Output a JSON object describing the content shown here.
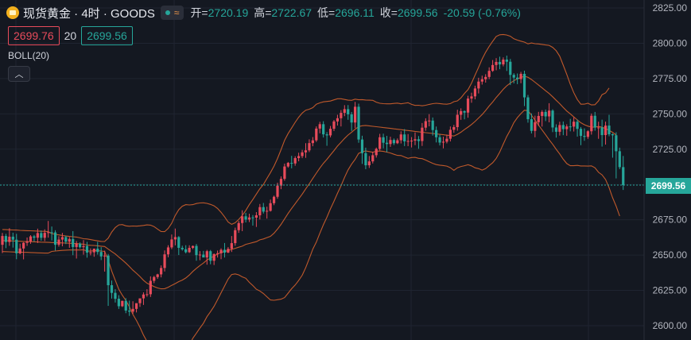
{
  "header": {
    "symbol_title": "现货黄金 · 4时 · GOODS",
    "open_label": "开=",
    "open_value": "2720.19",
    "high_label": "高=",
    "high_value": "2722.67",
    "low_label": "低=",
    "low_value": "2696.11",
    "close_label": "收=",
    "close_value": "2699.56",
    "change": "-20.59 (-0.76%)"
  },
  "bid_ask": {
    "sell": "2699.76",
    "spread": "20",
    "buy": "2699.56"
  },
  "indicator": {
    "label": "BOLL(20)",
    "collapse_icon": "chevron-up-icon"
  },
  "last_price_label": "2699.56",
  "colors": {
    "up": "#e84b5b",
    "down": "#26a69a",
    "band": "#c0592b",
    "background": "#141821",
    "grid": "#1f2431"
  },
  "chart_data": {
    "type": "candlestick",
    "ylim": [
      2593,
      2828
    ],
    "yticks": [
      "2825.00",
      "2800.00",
      "2775.00",
      "2750.00",
      "2725.00",
      "2700.00",
      "2675.00",
      "2650.00",
      "2625.00",
      "2600.00"
    ],
    "grid": true,
    "last_price": 2699.56,
    "open": [
      2657.29,
      2663.51,
      2659.29,
      2663.03,
      2660.92,
      2651.26,
      2654.67,
      2658.71,
      2659.69,
      2663.22,
      2662.29,
      2665.6,
      2662.25,
      2665.76,
      2666.2,
      2666.05,
      2657.3,
      2660.98,
      2662.76,
      2659.51,
      2661.38,
      2655.73,
      2658.08,
      2655.61,
      2656.4,
      2651.76,
      2651.98,
      2654.55,
      2652.2,
      2649.06,
      2649.65,
      2628.67,
      2623.24,
      2619.05,
      2613.79,
      2617.58,
      2610.72,
      2609.97,
      2611.9,
      2615.95,
      2619.36,
      2622.12,
      2622.28,
      2631.78,
      2634.44,
      2636.34,
      2640.86,
      2650.52,
      2655.43,
      2661.09,
      2662.75,
      2655.14,
      2654.11,
      2652.04,
      2655.14,
      2656.47,
      2649.96,
      2650.35,
      2648.32,
      2652.75,
      2645.98,
      2650.72,
      2651.29,
      2653.76,
      2651.78,
      2654.44,
      2658.46,
      2667.64,
      2672.69,
      2677.47,
      2675.17,
      2676.66,
      2676.5,
      2678.17,
      2683.97,
      2680.77,
      2681.34,
      2686.74,
      2691.28,
      2699.17,
      2703.97,
      2712.73,
      2715.29,
      2714.89,
      2718.67,
      2720.1,
      2722.74,
      2724.18,
      2729.3,
      2731.25,
      2739.58,
      2742.69,
      2735.5,
      2734.76,
      2739.44,
      2744.63,
      2746.91,
      2750.72,
      2753.33,
      2749.65,
      2743.87,
      2755.04,
      2731.84,
      2722.19,
      2713.59,
      2716.35,
      2720.71,
      2725.2,
      2733.43,
      2729.54,
      2728.63,
      2731.52,
      2729.22,
      2731.31,
      2735.43,
      2730.52,
      2730.81,
      2731.08,
      2732.02,
      2730.76,
      2740.23,
      2744.84,
      2745.25,
      2738.54,
      2733.43,
      2729.67,
      2730.3,
      2732.4,
      2738.73,
      2740.62,
      2749.35,
      2751.93,
      2750.9,
      2760.83,
      2762.39,
      2767.98,
      2772.85,
      2774.52,
      2776.15,
      2780.45,
      2784.59,
      2786.78,
      2785.02,
      2788.43,
      2786.9,
      2777.61,
      2775.68,
      2774.62,
      2778.34,
      2761.67,
      2746.22,
      2737.95,
      2744.07,
      2748.54,
      2751.38,
      2748.21,
      2752.31,
      2740.36,
      2737.31,
      2742.08,
      2739.17,
      2741.1,
      2740.96,
      2744.44,
      2739.39,
      2734.41,
      2733.72,
      2737.67,
      2748.66,
      2740.28,
      2740.38,
      2734.98,
      2741.7,
      2735.54,
      2734.83,
      2723.54,
      2712.29
    ],
    "high": [
      2665.69,
      2665.06,
      2669.06,
      2665.86,
      2665.06,
      2658.1,
      2659.12,
      2662.45,
      2664.1,
      2664.27,
      2668.71,
      2667.43,
      2668.22,
      2674.14,
      2670.23,
      2667.61,
      2663.33,
      2665.71,
      2663.8,
      2662.77,
      2666.98,
      2659.99,
      2659.01,
      2660.61,
      2659.37,
      2654.74,
      2654.63,
      2659.38,
      2655.62,
      2653.15,
      2650.81,
      2631.97,
      2625.87,
      2621.6,
      2617.74,
      2619.48,
      2617.76,
      2617.32,
      2615.93,
      2618.12,
      2623.61,
      2625.86,
      2634.92,
      2635.32,
      2636.76,
      2642.69,
      2653.3,
      2656.99,
      2664.59,
      2668.79,
      2663.41,
      2656.66,
      2656.99,
      2656.95,
      2656.75,
      2657.81,
      2652.8,
      2652.96,
      2653.68,
      2653.61,
      2651.15,
      2653.2,
      2654.79,
      2658.55,
      2655.71,
      2663.49,
      2669.44,
      2674.2,
      2681.74,
      2679.95,
      2679.29,
      2678.34,
      2680.42,
      2686.18,
      2686.91,
      2684.27,
      2689.3,
      2692.08,
      2701.25,
      2705.71,
      2714.77,
      2715.93,
      2720.27,
      2719.98,
      2722.48,
      2724.5,
      2729.25,
      2731.97,
      2733.56,
      2741.12,
      2744.36,
      2744.79,
      2737.12,
      2741.42,
      2745.67,
      2749.36,
      2752.67,
      2756.15,
      2756.23,
      2751.33,
      2758.47,
      2757.23,
      2734.52,
      2726.08,
      2720.15,
      2723.22,
      2726.12,
      2735.84,
      2735.97,
      2734.43,
      2733.82,
      2732.59,
      2732.59,
      2737.67,
      2739.21,
      2735.7,
      2733.54,
      2736.88,
      2734.3,
      2743.51,
      2746.86,
      2749.79,
      2747.43,
      2741.03,
      2735.27,
      2733.8,
      2735.33,
      2741.07,
      2742.19,
      2752.92,
      2753.92,
      2752.45,
      2762.8,
      2764.99,
      2769.95,
      2775.56,
      2777.05,
      2778.09,
      2782.94,
      2788.11,
      2789.46,
      2790.49,
      2789.99,
      2791.25,
      2788.89,
      2778.8,
      2778.58,
      2779.73,
      2780.58,
      2763.39,
      2750.34,
      2748.74,
      2751.42,
      2752.61,
      2753.07,
      2757.54,
      2753.21,
      2742.62,
      2744.43,
      2744.59,
      2742.62,
      2746.46,
      2747.53,
      2745.99,
      2740.68,
      2739.71,
      2738.35,
      2750.24,
      2751.37,
      2744.46,
      2745.89,
      2744.49,
      2749.35,
      2736.18,
      2736.97,
      2726.07,
      2720.19
    ],
    "low": [
      2651.43,
      2654.92,
      2656.58,
      2655.31,
      2647.07,
      2650.56,
      2646.97,
      2656.52,
      2658.0,
      2659.64,
      2658.52,
      2660.2,
      2659.87,
      2662.35,
      2660.37,
      2653.19,
      2655.97,
      2656.22,
      2657.8,
      2655.18,
      2649.95,
      2647.55,
      2654.63,
      2650.32,
      2648.16,
      2649.82,
      2648.82,
      2650.37,
      2646.46,
      2638.32,
      2614.03,
      2619.2,
      2616.41,
      2611.88,
      2613.25,
      2608.85,
      2606.93,
      2608.38,
      2609.41,
      2613.33,
      2614.7,
      2620.52,
      2620.34,
      2630.11,
      2633.14,
      2634.22,
      2638.4,
      2648.44,
      2654.19,
      2656.9,
      2650.06,
      2653.16,
      2651.19,
      2651.51,
      2654.21,
      2646.01,
      2646.38,
      2648.59,
      2643.2,
      2643.49,
      2642.96,
      2648.28,
      2647.09,
      2648.28,
      2651.4,
      2652.2,
      2656.62,
      2665.74,
      2666.95,
      2673.13,
      2673.39,
      2670.88,
      2669.93,
      2675.21,
      2679.45,
      2675.82,
      2680.81,
      2685.35,
      2689.91,
      2696.67,
      2702.68,
      2711.86,
      2711.43,
      2713.27,
      2716.41,
      2718.63,
      2718.85,
      2722.94,
      2727.07,
      2730.12,
      2736.23,
      2733.26,
      2727.38,
      2733.37,
      2737.85,
      2741.72,
      2741.09,
      2748.36,
      2745.81,
      2737.94,
      2739.89,
      2729.53,
      2714.56,
      2710.82,
      2711.72,
      2714.88,
      2719.04,
      2724.12,
      2725.56,
      2722.88,
      2726.61,
      2727.9,
      2728.61,
      2729.04,
      2727.19,
      2727.14,
      2726.2,
      2727.86,
      2725.29,
      2727.29,
      2738.04,
      2741.19,
      2734.61,
      2729.77,
      2727.62,
      2725.57,
      2729.09,
      2730.47,
      2736.65,
      2738.09,
      2745.78,
      2746.14,
      2747.27,
      2757.86,
      2760.29,
      2764.46,
      2770.73,
      2772.14,
      2774.59,
      2779.76,
      2780.87,
      2781.61,
      2783.64,
      2780.38,
      2770.39,
      2771.55,
      2771.04,
      2771.71,
      2755.51,
      2743.77,
      2736.12,
      2733.44,
      2741.41,
      2740.99,
      2744.89,
      2744.01,
      2737.07,
      2733.17,
      2734.64,
      2734.9,
      2734.5,
      2737.64,
      2737.49,
      2733.9,
      2727.83,
      2730.93,
      2732.29,
      2735.31,
      2738.06,
      2732.34,
      2726.83,
      2728.24,
      2734.12,
      2718.96,
      2704.29,
      2710.85,
      2696.11
    ],
    "close": [
      2663.51,
      2659.29,
      2663.03,
      2660.92,
      2651.26,
      2654.67,
      2658.71,
      2659.69,
      2663.22,
      2662.29,
      2665.6,
      2662.25,
      2665.76,
      2666.2,
      2666.05,
      2657.3,
      2660.98,
      2662.76,
      2659.51,
      2661.38,
      2655.73,
      2658.08,
      2655.61,
      2656.4,
      2651.76,
      2651.98,
      2654.55,
      2652.2,
      2649.06,
      2649.65,
      2628.67,
      2623.24,
      2619.05,
      2613.79,
      2617.58,
      2610.72,
      2609.97,
      2611.9,
      2615.95,
      2619.36,
      2622.12,
      2622.28,
      2631.78,
      2634.44,
      2636.34,
      2640.86,
      2650.52,
      2655.43,
      2661.09,
      2662.75,
      2655.14,
      2654.11,
      2652.04,
      2655.14,
      2656.47,
      2649.96,
      2650.35,
      2648.32,
      2652.75,
      2645.98,
      2650.72,
      2651.29,
      2653.76,
      2651.78,
      2654.44,
      2658.46,
      2667.64,
      2672.69,
      2677.47,
      2675.17,
      2676.66,
      2676.5,
      2678.17,
      2683.97,
      2680.77,
      2681.34,
      2686.74,
      2691.28,
      2699.17,
      2703.97,
      2712.73,
      2715.29,
      2714.89,
      2718.67,
      2720.1,
      2722.74,
      2724.18,
      2729.3,
      2731.25,
      2739.58,
      2742.69,
      2735.5,
      2734.76,
      2739.44,
      2744.63,
      2746.91,
      2750.72,
      2753.33,
      2749.65,
      2743.87,
      2755.04,
      2731.84,
      2722.19,
      2713.59,
      2716.35,
      2720.71,
      2725.2,
      2733.43,
      2729.54,
      2728.63,
      2731.52,
      2729.22,
      2731.31,
      2735.43,
      2730.52,
      2730.81,
      2731.08,
      2732.02,
      2730.76,
      2740.23,
      2744.84,
      2745.25,
      2738.54,
      2733.43,
      2729.67,
      2730.3,
      2732.4,
      2738.73,
      2740.62,
      2749.35,
      2751.93,
      2750.9,
      2760.83,
      2762.39,
      2767.98,
      2772.85,
      2774.52,
      2776.15,
      2780.45,
      2784.59,
      2786.78,
      2785.02,
      2788.43,
      2786.9,
      2777.61,
      2775.68,
      2774.62,
      2778.34,
      2761.67,
      2746.22,
      2737.95,
      2744.07,
      2748.54,
      2751.38,
      2748.21,
      2752.31,
      2740.36,
      2737.31,
      2742.08,
      2739.17,
      2741.1,
      2740.96,
      2744.44,
      2739.39,
      2734.41,
      2733.72,
      2737.67,
      2748.66,
      2740.28,
      2740.38,
      2734.98,
      2741.7,
      2735.54,
      2734.83,
      2723.54,
      2712.29,
      2699.56
    ],
    "boll_upper": [
      2668.1,
      2668.0,
      2667.9,
      2667.8,
      2667.7,
      2667.5,
      2667.4,
      2667.3,
      2667.2,
      2667.1,
      2667.0,
      2666.9,
      2666.8,
      2666.6,
      2665.2,
      2664.7,
      2664.3,
      2663.9,
      2663.5,
      2663.2,
      2663.0,
      2662.8,
      2662.2,
      2661.6,
      2661.4,
      2661.0,
      2660.5,
      2660.1,
      2659.7,
      2659.6,
      2662.0,
      2666.3,
      2669.5,
      2671.4,
      2671.6,
      2670.7,
      2670.4,
      2670.6,
      2670.5,
      2670.7,
      2671.0,
      2671.4,
      2671.2,
      2670.2,
      2668.4,
      2666.7,
      2666.6,
      2668.9,
      2672.5,
      2678.1,
      2682.1,
      2684.6,
      2685.7,
      2685.5,
      2685.7,
      2686.5,
      2686.9,
      2687.0,
      2686.6,
      2685.9,
      2684.9,
      2683.0,
      2680.3,
      2677.0,
      2673.4,
      2671.8,
      2672.9,
      2675.2,
      2678.0,
      2681.6,
      2685.7,
      2689.4,
      2693.2,
      2697.0,
      2700.0,
      2704.3,
      2708.4,
      2713.0,
      2718.4,
      2724.6,
      2731.3,
      2736.0,
      2740.0,
      2744.0,
      2747.6,
      2750.6,
      2752.6,
      2753.3,
      2754.4,
      2756.8,
      2757.8,
      2758.5,
      2758.8,
      2759.1,
      2759.9,
      2760.7,
      2760.7,
      2760.2,
      2759.7,
      2759.6,
      2760.4,
      2760.0,
      2760.1,
      2759.8,
      2759.7,
      2759.6,
      2758.3,
      2757.5,
      2757.2,
      2757.1,
      2757.1,
      2757.4,
      2757.6,
      2757.1,
      2757.5,
      2757.9,
      2756.7,
      2756.0,
      2756.1,
      2755.7,
      2756.1,
      2756.7,
      2757.2,
      2757.5,
      2757.3,
      2757.0,
      2756.8,
      2757.3,
      2758.6,
      2759.2,
      2761.3,
      2764.5,
      2767.2,
      2771.8,
      2777.4,
      2783.0,
      2788.8,
      2793.6,
      2797.8,
      2801.4,
      2804.8,
      2806.0,
      2806.2,
      2805.8,
      2805.0,
      2803.2,
      2802.2,
      2801.5,
      2800.8,
      2799.6,
      2800.2,
      2799.7,
      2799.5,
      2799.2,
      2798.8,
      2798.5,
      2797.1,
      2794.7,
      2790.8,
      2784.5,
      2777.9,
      2771.0,
      2765.0,
      2760.1,
      2756.8,
      2756.9,
      2757.5,
      2756.3,
      2756.5,
      2759.2,
      2763.6,
      2764.8,
      2768.3
    ],
    "boll_mid": [
      2660.3,
      2660.2,
      2660.1,
      2660.0,
      2659.9,
      2659.8,
      2659.7,
      2659.6,
      2659.5,
      2659.4,
      2659.3,
      2659.2,
      2659.1,
      2659.0,
      2658.9,
      2658.8,
      2658.7,
      2658.6,
      2658.5,
      2658.4,
      2658.3,
      2658.2,
      2657.9,
      2657.7,
      2657.1,
      2656.9,
      2656.8,
      2656.6,
      2656.3,
      2656.1,
      2654.2,
      2652.5,
      2650.8,
      2648.6,
      2646.6,
      2644.3,
      2641.9,
      2639.3,
      2637.1,
      2634.8,
      2632.2,
      2630.1,
      2628.9,
      2627.7,
      2626.7,
      2626.1,
      2626.2,
      2627.2,
      2628.6,
      2629.8,
      2631.2,
      2632.3,
      2633.8,
      2635.9,
      2638.4,
      2640.6,
      2642.6,
      2644.4,
      2646.5,
      2647.9,
      2649.3,
      2650.7,
      2651.8,
      2652.6,
      2653.2,
      2654.0,
      2654.8,
      2655.6,
      2656.3,
      2657.6,
      2658.2,
      2658.9,
      2659.5,
      2660.8,
      2661.4,
      2662.4,
      2663.3,
      2665.5,
      2668.4,
      2671.7,
      2675.6,
      2679.5,
      2683.1,
      2686.4,
      2689.8,
      2693.2,
      2696.9,
      2700.4,
      2704.3,
      2708.0,
      2711.6,
      2715.0,
      2717.8,
      2720.9,
      2724.0,
      2727.2,
      2729.9,
      2732.6,
      2735.0,
      2737.0,
      2739.1,
      2741.0,
      2741.6,
      2741.8,
      2741.5,
      2741.2,
      2740.9,
      2740.6,
      2740.3,
      2740.0,
      2739.7,
      2739.4,
      2739.1,
      2738.8,
      2738.5,
      2738.2,
      2737.9,
      2737.6,
      2737.3,
      2737.0,
      2736.7,
      2736.4,
      2736.1,
      2735.8,
      2735.5,
      2735.2,
      2734.9,
      2734.6,
      2734.3,
      2735.5,
      2737.0,
      2738.9,
      2740.6,
      2742.5,
      2744.6,
      2747.1,
      2749.5,
      2752.4,
      2755.6,
      2758.4,
      2761.6,
      2764.5,
      2767.4,
      2769.9,
      2771.8,
      2773.5,
      2774.8,
      2775.7,
      2776.7,
      2775.9,
      2774.3,
      2772.4,
      2770.4,
      2768.4,
      2766.4,
      2764.4,
      2762.1,
      2759.6,
      2757.2,
      2754.6,
      2752.0,
      2750.0,
      2747.8,
      2745.7,
      2743.7,
      2742.3,
      2741.3,
      2740.6,
      2740.6,
      2741.1,
      2740.5,
      2739.6,
      2738.3,
      2736.9,
      2735.0
    ],
    "boll_lower": [
      2652.5,
      2652.4,
      2652.3,
      2652.2,
      2652.1,
      2652.1,
      2652.0,
      2651.9,
      2651.8,
      2651.7,
      2651.6,
      2651.5,
      2651.4,
      2651.4,
      2652.6,
      2652.9,
      2653.1,
      2653.3,
      2653.5,
      2653.6,
      2653.6,
      2653.6,
      2653.6,
      2653.8,
      2652.8,
      2652.8,
      2653.1,
      2653.1,
      2652.9,
      2652.6,
      2646.4,
      2638.7,
      2632.1,
      2625.8,
      2621.6,
      2617.9,
      2613.4,
      2608.0,
      2603.7,
      2598.9,
      2593.4,
      2588.8,
      2586.6,
      2585.2,
      2585.0,
      2585.5,
      2585.8,
      2585.5,
      2584.7,
      2581.5,
      2580.3,
      2580.0,
      2581.9,
      2586.3,
      2591.1,
      2594.7,
      2598.3,
      2601.8,
      2606.4,
      2609.9,
      2613.7,
      2618.4,
      2623.3,
      2628.2,
      2633.0,
      2636.2,
      2636.7,
      2636.0,
      2634.6,
      2633.6,
      2630.7,
      2628.4,
      2625.8,
      2624.6,
      2622.8,
      2620.5,
      2618.2,
      2618.0,
      2618.4,
      2618.8,
      2619.9,
      2623.0,
      2626.2,
      2628.8,
      2632.0,
      2635.8,
      2641.2,
      2647.5,
      2654.2,
      2659.2,
      2665.4,
      2671.5,
      2676.8,
      2682.7,
      2688.1,
      2693.7,
      2699.1,
      2705.0,
      2710.3,
      2714.4,
      2717.8,
      2722.0,
      2723.1,
      2723.8,
      2723.3,
      2722.8,
      2723.5,
      2723.7,
      2723.4,
      2722.9,
      2722.3,
      2721.4,
      2720.6,
      2720.5,
      2719.5,
      2718.5,
      2719.1,
      2719.2,
      2718.5,
      2718.3,
      2717.3,
      2716.1,
      2715.0,
      2714.1,
      2713.7,
      2713.4,
      2713.0,
      2711.9,
      2710.0,
      2711.8,
      2712.7,
      2713.3,
      2714.0,
      2713.2,
      2711.8,
      2711.2,
      2710.2,
      2711.2,
      2713.4,
      2715.4,
      2718.4,
      2723.0,
      2728.6,
      2734.0,
      2738.6,
      2743.8,
      2747.4,
      2750.2,
      2752.6,
      2752.2,
      2749.0,
      2745.6,
      2742.1,
      2738.6,
      2735.2,
      2731.7,
      2728.5,
      2724.9,
      2721.6,
      2717.9,
      2714.8,
      2713.3,
      2713.3,
      2713.5,
      2713.1,
      2713.1,
      2713.0,
      2713.2,
      2711.8,
      2708.6,
      2706.8,
      2703.5,
      2697.7,
      2690.6,
      2684.6,
      2677.6
    ]
  }
}
